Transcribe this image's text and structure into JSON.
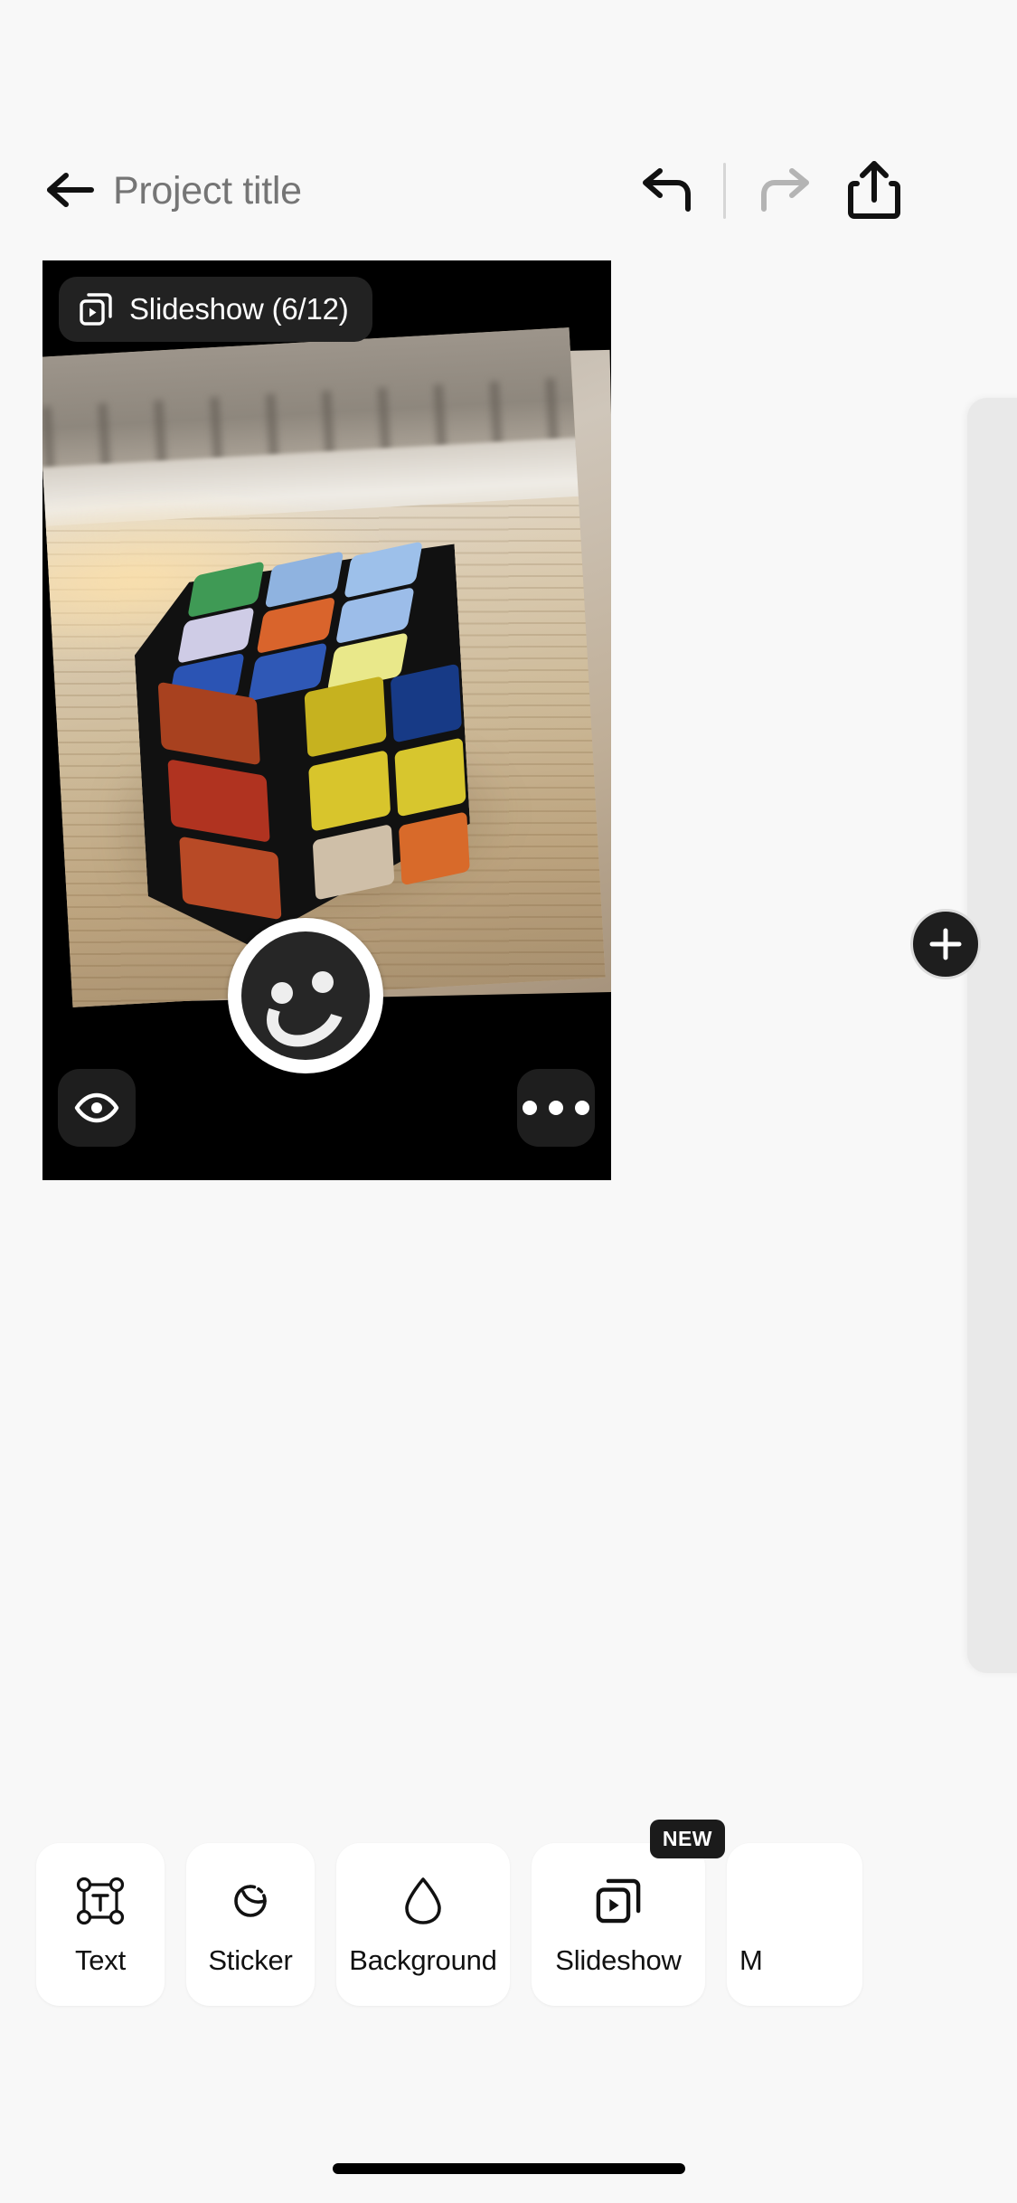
{
  "app": {
    "background_color": "#f8f8f8",
    "accent_dark": "#1b1b1b"
  },
  "header": {
    "back_icon": "arrow-left-icon",
    "title_value": "",
    "title_placeholder": "Project title",
    "undo_label": "Undo",
    "undo_icon": "undo-arrow-icon",
    "undo_enabled": "true",
    "redo_label": "Redo",
    "redo_icon": "redo-arrow-icon",
    "redo_enabled": "false",
    "share_label": "Share",
    "share_icon": "share-upload-icon"
  },
  "canvas": {
    "background_color": "#000000",
    "badge": {
      "icon": "slideshow-stack-icon",
      "label": "Slideshow (6/12)",
      "current_slide": 6,
      "total_slides": 12
    },
    "preview_button": {
      "icon": "eye-icon",
      "label": "Preview"
    },
    "more_button": {
      "icon": "ellipsis-icon",
      "label": "More options"
    },
    "add_button": {
      "icon": "plus-icon",
      "label": "Add slide"
    },
    "photo": {
      "subject": "Rubik's cube on a wooden desk",
      "cube": {
        "top_face": [
          [
            "#3f9a55",
            "#8fb3e0",
            "#9dc0ea"
          ],
          [
            "#c9c6e4",
            "#d9642c",
            "#9cbde9"
          ],
          [
            "#2b54b4",
            "#2f58b6",
            "#e9e88a"
          ]
        ],
        "left_face": [
          [
            "#a8411f",
            "#b03320",
            "#ba4726"
          ],
          [
            "#b03320",
            "#ba4726",
            "#b84a26"
          ]
        ],
        "right_face": [
          [
            "#c6b21f",
            "#173a86",
            "#d4c02a"
          ],
          [
            "#d8c52c",
            "#d7c62e",
            "#cfbfa8"
          ],
          [
            "#c9b9a4",
            "#d86a2a",
            "#d86a2a"
          ]
        ]
      }
    },
    "sticker": {
      "name": "smiley-sticker",
      "face_color": "#262626",
      "border_color": "#ffffff"
    }
  },
  "toolbar": {
    "items": [
      {
        "label": "Text",
        "icon": "text-box-icon",
        "badge": ""
      },
      {
        "label": "Sticker",
        "icon": "sticker-peel-icon",
        "badge": ""
      },
      {
        "label": "Background",
        "icon": "droplet-icon",
        "badge": ""
      },
      {
        "label": "Slideshow",
        "icon": "slideshow-stack-icon",
        "badge": "NEW"
      },
      {
        "label": "M",
        "icon": "partial-icon",
        "badge": ""
      }
    ]
  },
  "system": {
    "home_indicator": "home-indicator"
  }
}
